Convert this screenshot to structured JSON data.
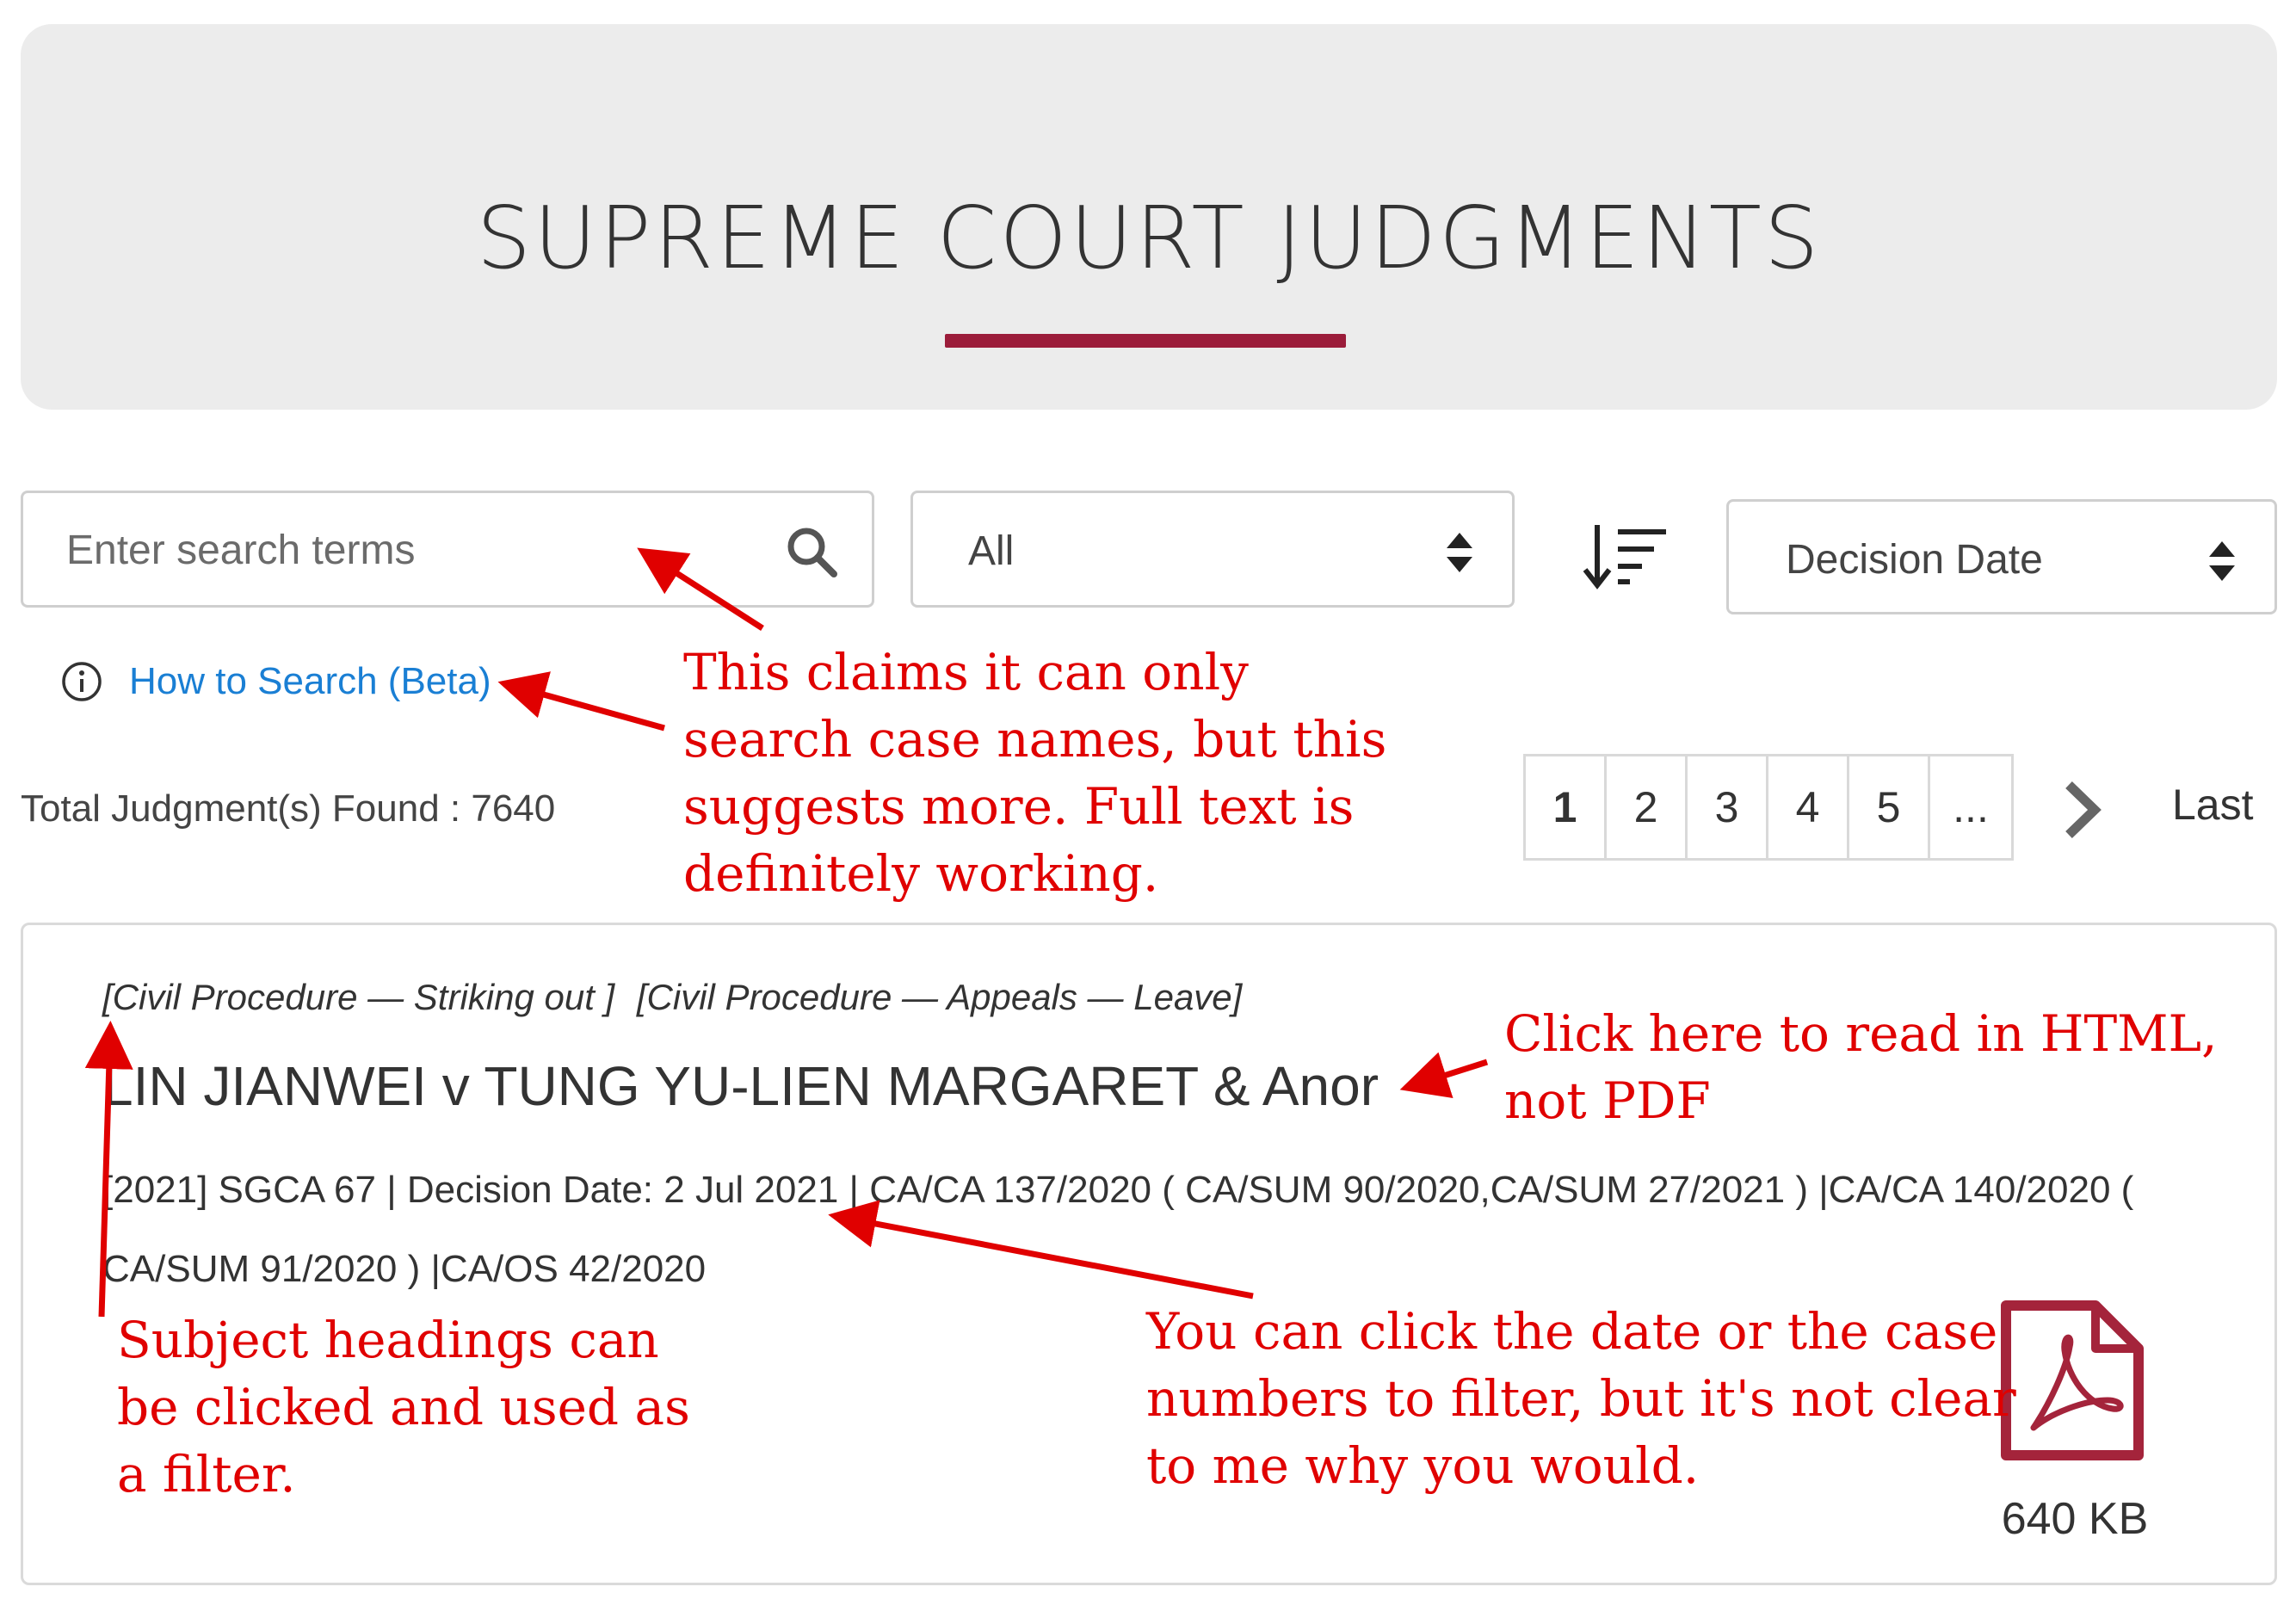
{
  "banner": {
    "title": "SUPREME COURT JUDGMENTS",
    "accent_color": "#9b1c3a"
  },
  "search": {
    "placeholder": "Enter search terms",
    "icon": "search-icon"
  },
  "filter_select": {
    "value": "All"
  },
  "sort": {
    "icon": "sort-descending-icon",
    "field": "Decision Date"
  },
  "help": {
    "label": "How to Search (Beta)",
    "icon": "info-icon"
  },
  "results": {
    "total_text": "Total Judgment(s) Found : 7640"
  },
  "pagination": {
    "pages": [
      "1",
      "2",
      "3",
      "4",
      "5",
      "..."
    ],
    "current": "1",
    "next_icon": "chevron-right-icon",
    "last_label": "Last"
  },
  "judgment": {
    "subjects": [
      "[Civil Procedure — Striking out ]",
      "[Civil Procedure — Appeals — Leave]"
    ],
    "title": "LIN JIANWEI v TUNG YU-LIEN MARGARET & Anor",
    "citation": "[2021] SGCA 67",
    "decision_date": "Decision Date: 2 Jul 2021",
    "case_numbers_line1": "CA/CA 137/2020 ( CA/SUM 90/2020,CA/SUM 27/2021 ) |CA/CA 140/2020 (",
    "case_numbers_line2": "CA/SUM 91/2020 ) |CA/OS 42/2020",
    "separator": "|",
    "pdf_icon": "pdf-file-icon",
    "pdf_size": "640 KB"
  },
  "annotations": {
    "search_note": [
      "This claims it can only",
      "search case names, but this",
      "suggests more. Full text is",
      "definitely working."
    ],
    "html_note": [
      "Click here to read in HTML,",
      "not PDF"
    ],
    "subject_note": [
      "Subject headings can",
      "be clicked and used as",
      "a filter."
    ],
    "filter_note": [
      "You can click the date or the case",
      "numbers to filter, but it's not clear",
      "to me why you would."
    ],
    "color": "#e00000"
  }
}
